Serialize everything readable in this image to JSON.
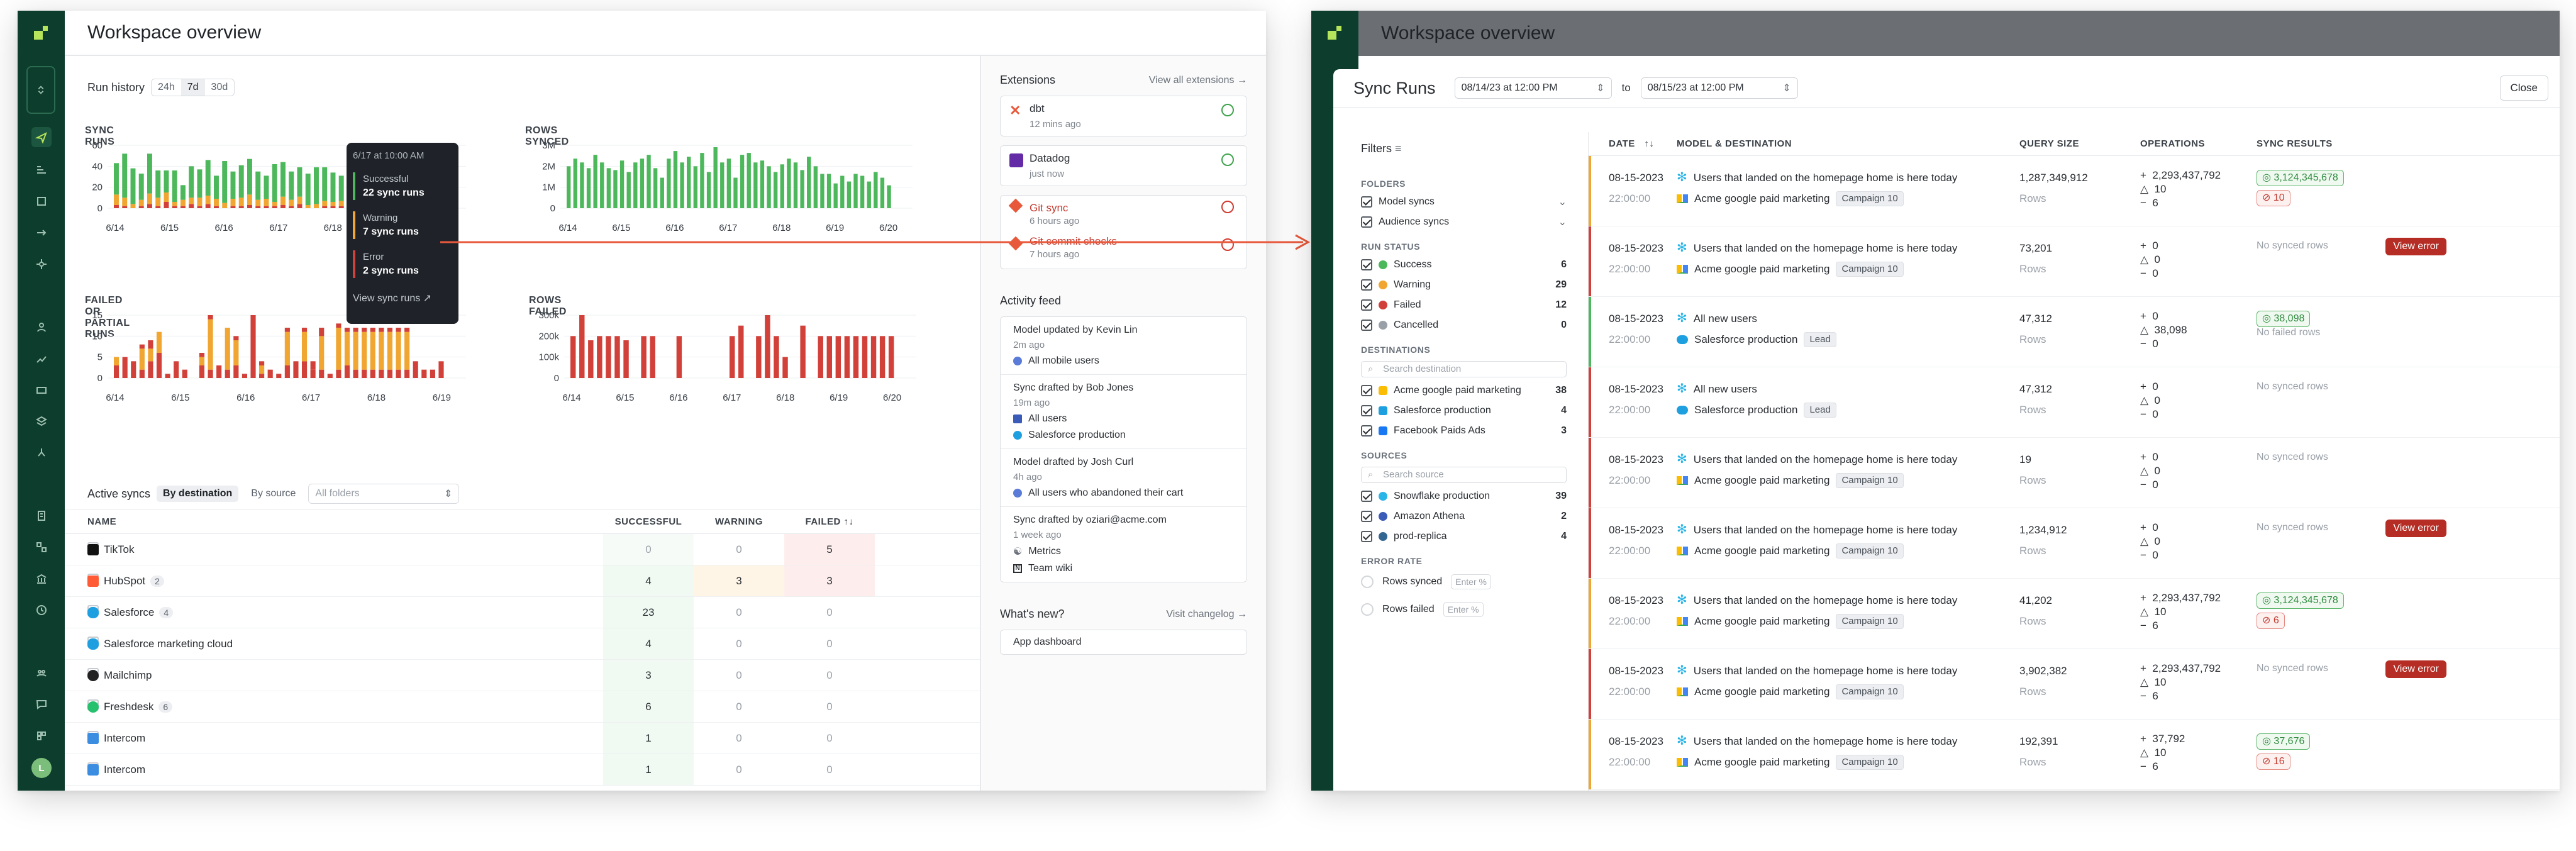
{
  "left": {
    "title": "Workspace overview",
    "run_history": {
      "label": "Run history",
      "ranges": [
        "24h",
        "7d",
        "30d"
      ],
      "active": "7d"
    },
    "charts": [
      {
        "title": "SYNC RUNS",
        "yticks": [
          "60",
          "40",
          "20",
          "0"
        ],
        "xticks": [
          "6/14",
          "6/15",
          "6/16",
          "6/17",
          "6/18",
          "6/19",
          "6/20"
        ]
      },
      {
        "title": "ROWS SYNCED",
        "yticks": [
          "3M",
          "2M",
          "1M",
          "0"
        ],
        "xticks": [
          "6/14",
          "6/15",
          "6/16",
          "6/17",
          "6/18",
          "6/19",
          "6/20"
        ]
      },
      {
        "title": "FAILED OR PARTIAL RUNS",
        "yticks": [
          "15",
          "10",
          "5",
          "0"
        ],
        "xticks": [
          "6/14",
          "6/15",
          "6/16",
          "6/17",
          "6/18",
          "6/19"
        ]
      },
      {
        "title": "ROWS FAILED",
        "yticks": [
          "300k",
          "200k",
          "100k",
          "0"
        ],
        "xticks": [
          "6/14",
          "6/15",
          "6/16",
          "6/17",
          "6/18",
          "6/19",
          "6/20"
        ]
      }
    ],
    "tooltip": {
      "time": "6/17 at 10:00 AM",
      "success_label": "Successful",
      "success_value": "22 sync runs",
      "warning_label": "Warning",
      "warning_value": "7 sync runs",
      "error_label": "Error",
      "error_value": "2 sync runs",
      "link": "View sync runs"
    },
    "active_syncs": {
      "label": "Active syncs",
      "tabs": [
        "By destination",
        "By source"
      ],
      "folder_placeholder": "All folders",
      "columns": [
        "NAME",
        "SUCCESSFUL",
        "WARNING",
        "FAILED"
      ],
      "rows": [
        {
          "name": "TikTok",
          "badge": "",
          "s": "0",
          "w": "0",
          "f": "5"
        },
        {
          "name": "HubSpot",
          "badge": "2",
          "s": "4",
          "w": "3",
          "f": "3"
        },
        {
          "name": "Salesforce",
          "badge": "4",
          "s": "23",
          "w": "0",
          "f": "0"
        },
        {
          "name": "Salesforce marketing cloud",
          "badge": "",
          "s": "4",
          "w": "0",
          "f": "0"
        },
        {
          "name": "Mailchimp",
          "badge": "",
          "s": "3",
          "w": "0",
          "f": "0"
        },
        {
          "name": "Freshdesk",
          "badge": "6",
          "s": "6",
          "w": "0",
          "f": "0"
        },
        {
          "name": "Intercom",
          "badge": "",
          "s": "1",
          "w": "0",
          "f": "0"
        },
        {
          "name": "Intercom",
          "badge": "",
          "s": "1",
          "w": "0",
          "f": "0"
        }
      ]
    },
    "extensions": {
      "label": "Extensions",
      "link": "View all extensions",
      "items": [
        {
          "name": "dbt",
          "sub": "12 mins ago"
        },
        {
          "name": "Datadog",
          "sub": "just now"
        },
        {
          "name": "Git sync",
          "sub": "6 hours ago"
        },
        {
          "name": "Git commit checks",
          "sub": "7 hours ago"
        }
      ]
    },
    "activity": {
      "label": "Activity feed",
      "items": [
        {
          "title": "Model updated by Kevin Lin",
          "time": "2m ago",
          "lines": [
            "All mobile users"
          ]
        },
        {
          "title": "Sync drafted by Bob Jones",
          "time": "19m ago",
          "lines": [
            "All users",
            "Salesforce production"
          ]
        },
        {
          "title": "Model drafted by Josh Curl",
          "time": "4h ago",
          "lines": [
            "All users who abandoned their cart"
          ]
        },
        {
          "title": "Sync drafted by oziari@acme.com",
          "time": "1 week ago",
          "lines": [
            "Metrics",
            "Team wiki"
          ]
        }
      ]
    },
    "whats_new": {
      "label": "What's new?",
      "link": "Visit changelog",
      "item": "App dashboard"
    }
  },
  "right": {
    "title": "Workspace overview",
    "panel_title": "Sync Runs",
    "from": "08/14/23 at 12:00 PM",
    "to_label": "to",
    "to": "08/15/23 at 12:00 PM",
    "close": "Close",
    "filters": {
      "label": "Filters",
      "folders_h": "FOLDERS",
      "folders": [
        "Model syncs",
        "Audience syncs"
      ],
      "status_h": "RUN STATUS",
      "status": [
        {
          "label": "Success",
          "count": "6"
        },
        {
          "label": "Warning",
          "count": "29"
        },
        {
          "label": "Failed",
          "count": "12"
        },
        {
          "label": "Cancelled",
          "count": "0"
        }
      ],
      "dest_h": "DESTINATIONS",
      "dest_search": "Search destination",
      "dests": [
        {
          "label": "Acme google paid marketing",
          "count": "38"
        },
        {
          "label": "Salesforce production",
          "count": "4"
        },
        {
          "label": "Facebook Paids Ads",
          "count": "3"
        }
      ],
      "src_h": "SOURCES",
      "src_search": "Search source",
      "srcs": [
        {
          "label": "Snowflake production",
          "count": "39"
        },
        {
          "label": "Amazon Athena",
          "count": "2"
        },
        {
          "label": "prod-replica",
          "count": "4"
        }
      ],
      "err_h": "ERROR RATE",
      "err": [
        {
          "label": "Rows synced",
          "ph": "Enter %"
        },
        {
          "label": "Rows failed",
          "ph": "Enter %"
        }
      ]
    },
    "columns": [
      "DATE",
      "MODEL & DESTINATION",
      "QUERY SIZE",
      "OPERATIONS",
      "SYNC RESULTS"
    ],
    "rows_label": "Rows",
    "view_error": "View error",
    "rows": [
      {
        "date": "08-15-2023",
        "time": "22:00:00",
        "model": "Users that landed on the homepage home is here today",
        "dest": "Acme google paid marketing",
        "tag": "Campaign 10",
        "size": "1,287,349,912",
        "ops": [
          "2,293,437,792",
          "10",
          "6"
        ],
        "res1": "3,124,345,678",
        "res2": "10",
        "none": ""
      },
      {
        "date": "08-15-2023",
        "time": "22:00:00",
        "model": "Users that landed on the homepage home is here today",
        "dest": "Acme google paid marketing",
        "tag": "Campaign 10",
        "size": "73,201",
        "ops": [
          "0",
          "0",
          "0"
        ],
        "res1": "",
        "res2": "",
        "none": "No synced rows"
      },
      {
        "date": "08-15-2023",
        "time": "22:00:00",
        "model": "All new users",
        "dest": "Salesforce production",
        "tag": "Lead",
        "size": "47,312",
        "ops": [
          "0",
          "38,098",
          "0"
        ],
        "res1": "38,098",
        "res2": "",
        "none": "No failed rows"
      },
      {
        "date": "08-15-2023",
        "time": "22:00:00",
        "model": "All new users",
        "dest": "Salesforce production",
        "tag": "Lead",
        "size": "47,312",
        "ops": [
          "0",
          "0",
          "0"
        ],
        "res1": "",
        "res2": "",
        "none": "No synced rows"
      },
      {
        "date": "08-15-2023",
        "time": "22:00:00",
        "model": "Users that landed on the homepage home is here today",
        "dest": "Acme google paid marketing",
        "tag": "Campaign 10",
        "size": "19",
        "ops": [
          "0",
          "0",
          "0"
        ],
        "res1": "",
        "res2": "",
        "none": "No synced rows"
      },
      {
        "date": "08-15-2023",
        "time": "22:00:00",
        "model": "Users that landed on the homepage home is here today",
        "dest": "Acme google paid marketing",
        "tag": "Campaign 10",
        "size": "1,234,912",
        "ops": [
          "0",
          "0",
          "0"
        ],
        "res1": "",
        "res2": "",
        "none": "No synced rows"
      },
      {
        "date": "08-15-2023",
        "time": "22:00:00",
        "model": "Users that landed on the homepage home is here today",
        "dest": "Acme google paid marketing",
        "tag": "Campaign 10",
        "size": "41,202",
        "ops": [
          "2,293,437,792",
          "10",
          "6"
        ],
        "res1": "3,124,345,678",
        "res2": "6",
        "none": ""
      },
      {
        "date": "08-15-2023",
        "time": "22:00:00",
        "model": "Users that landed on the homepage home is here today",
        "dest": "Acme google paid marketing",
        "tag": "Campaign 10",
        "size": "3,902,382",
        "ops": [
          "2,293,437,792",
          "10",
          "6"
        ],
        "res1": "",
        "res2": "",
        "none": "No synced rows"
      },
      {
        "date": "08-15-2023",
        "time": "22:00:00",
        "model": "Users that landed on the homepage home is here today",
        "dest": "Acme google paid marketing",
        "tag": "Campaign 10",
        "size": "192,391",
        "ops": [
          "37,792",
          "10",
          "6"
        ],
        "res1": "37,676",
        "res2": "16",
        "none": ""
      }
    ]
  },
  "colors": {
    "brand_dark": "#0d3d2c",
    "brand_lime": "#b6e45a",
    "success": "#4cb85b",
    "warning": "#f0a630",
    "failed": "#d2403a",
    "accent_arrow": "#e8593c"
  }
}
